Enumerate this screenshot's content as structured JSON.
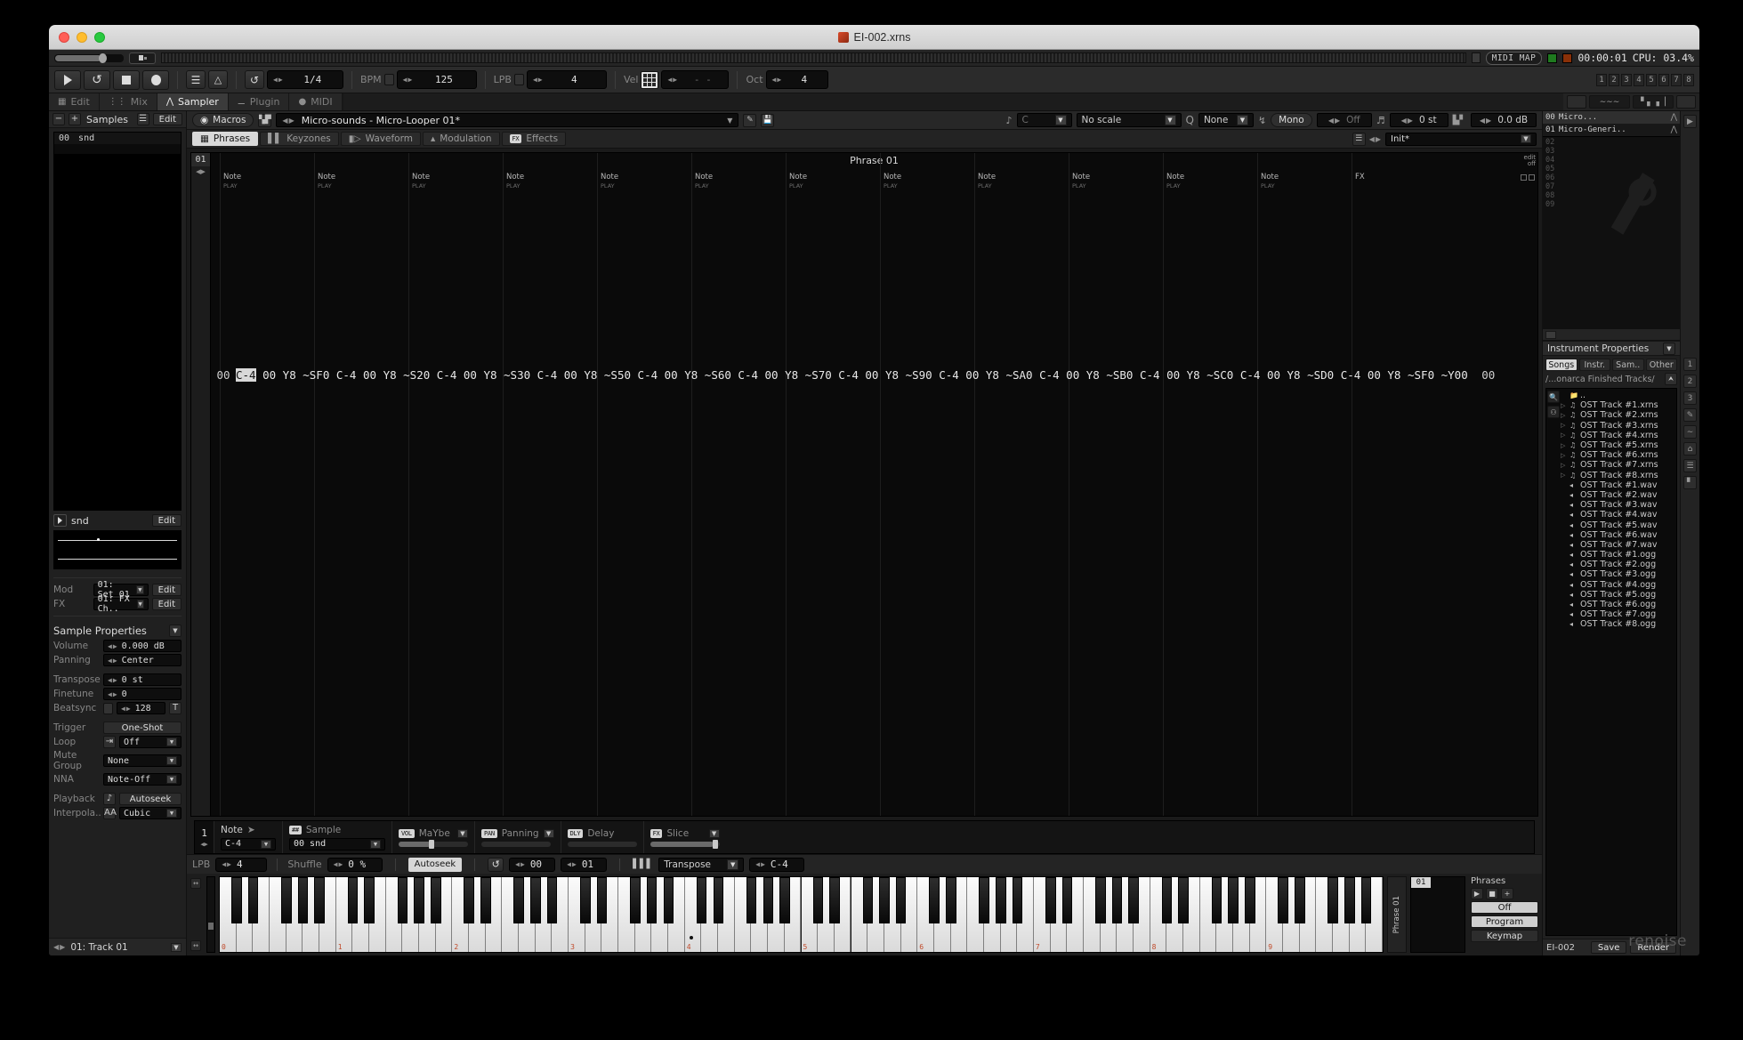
{
  "window": {
    "title": "EI-002.xrns",
    "app_icon": "renoise-icon",
    "branding": "renoise"
  },
  "master_strip": {
    "midi_map_label": "MIDI MAP",
    "time": "00:00:01",
    "cpu": "CPU: 03.4%"
  },
  "transport": {
    "play": "play-button",
    "loop": "loop-button",
    "stop": "stop-button",
    "record": "record-button",
    "metronome_icon": "metronome-icon",
    "pattern_follow_icon": "follow-icon",
    "edit_step_loop_icon": "loop-icon",
    "edit_step": "1/4",
    "bpm_label": "BPM",
    "bpm": "125",
    "lpb_label": "LPB",
    "lpb": "4",
    "vel_label": "Vel",
    "vel": "- -",
    "oct_label": "Oct",
    "oct": "4",
    "seq_numbers": [
      "1",
      "2",
      "3",
      "4",
      "5",
      "6",
      "7",
      "8"
    ]
  },
  "top_tabs": [
    {
      "label": "Edit",
      "icon": "grid-icon",
      "active": false
    },
    {
      "label": "Mix",
      "icon": "faders-icon",
      "active": false
    },
    {
      "label": "Sampler",
      "icon": "waveform-icon",
      "active": true
    },
    {
      "label": "Plugin",
      "icon": "plug-icon",
      "active": false
    },
    {
      "label": "MIDI",
      "icon": "midi-icon",
      "active": false
    }
  ],
  "left_panel": {
    "header": {
      "minus": "−",
      "plus": "+",
      "title": "Samples",
      "list_icon": "list-icon",
      "edit": "Edit"
    },
    "sample_rows": [
      {
        "index": "00",
        "name": "snd"
      }
    ],
    "sample_name": "snd",
    "sample_edit": "Edit",
    "mod_label": "Mod",
    "mod_value": "01: Set 01",
    "mod_edit": "Edit",
    "fx_label": "FX",
    "fx_value": "01: FX Ch..",
    "fx_edit": "Edit",
    "properties_title": "Sample Properties",
    "properties": [
      {
        "label": "Volume",
        "value": "0.000 dB",
        "kind": "spin"
      },
      {
        "label": "Panning",
        "value": "Center",
        "kind": "spin"
      },
      {
        "label": "Transpose",
        "value": "0 st",
        "kind": "spin"
      },
      {
        "label": "Finetune",
        "value": "0",
        "kind": "spin"
      },
      {
        "label": "Beatsync",
        "value": "128",
        "kind": "spin-check",
        "suffix": "T"
      },
      {
        "label": "Trigger",
        "value": "One-Shot",
        "kind": "button"
      },
      {
        "label": "Loop",
        "value": "Off",
        "kind": "dropdown",
        "icon": "loop-range-icon"
      },
      {
        "label": "Mute Group",
        "value": "None",
        "kind": "dropdown"
      },
      {
        "label": "NNA",
        "value": "Note-Off",
        "kind": "dropdown"
      },
      {
        "label": "Playback",
        "value": "Autoseek",
        "kind": "button",
        "icon": "speaker-icon"
      },
      {
        "label": "Interpola..",
        "value": "Cubic",
        "kind": "dropdown",
        "icon": "AA"
      }
    ],
    "track_selector": "01: Track 01"
  },
  "instrument_bar": {
    "macros_label": "Macros",
    "instrument_name": "Micro-sounds - Micro-Looper 01*",
    "key_value": "C",
    "scale_value": "No scale",
    "quantize_label": "Q",
    "quantize_value": "None",
    "mono_label": "Mono",
    "glide_value": "Off",
    "transpose_value": "0 st",
    "volume_value": "0.0 dB"
  },
  "instrument_tabs": [
    {
      "label": "Phrases",
      "icon": "grid-icon",
      "active": true
    },
    {
      "label": "Keyzones",
      "icon": "keyzone-icon",
      "active": false
    },
    {
      "label": "Waveform",
      "icon": "waveform-icon",
      "active": false
    },
    {
      "label": "Modulation",
      "icon": "envelope-icon",
      "active": false
    },
    {
      "label": "Effects",
      "icon": "fx-icon",
      "active": false
    }
  ],
  "preset": {
    "value": "Init*"
  },
  "phrase_editor": {
    "row_index": "01",
    "title": "Phrase 01",
    "edit_mode_label": "edit\noff",
    "column_header_label": "Note",
    "column_header_sub": "PLAY",
    "fx_header": "FX",
    "column_count": 12,
    "row_label_left": "00",
    "row_label_right": "00",
    "pattern_cells": [
      {
        "note": "C-4",
        "vol": "00",
        "pan": "Y8",
        "fx": "~SF0",
        "selected": true
      },
      {
        "note": "C-4",
        "vol": "00",
        "pan": "Y8",
        "fx": "~S20",
        "selected": false
      },
      {
        "note": "C-4",
        "vol": "00",
        "pan": "Y8",
        "fx": "~S30",
        "selected": false
      },
      {
        "note": "C-4",
        "vol": "00",
        "pan": "Y8",
        "fx": "~S50",
        "selected": false
      },
      {
        "note": "C-4",
        "vol": "00",
        "pan": "Y8",
        "fx": "~S60",
        "selected": false
      },
      {
        "note": "C-4",
        "vol": "00",
        "pan": "Y8",
        "fx": "~S70",
        "selected": false
      },
      {
        "note": "C-4",
        "vol": "00",
        "pan": "Y8",
        "fx": "~S90",
        "selected": false
      },
      {
        "note": "C-4",
        "vol": "00",
        "pan": "Y8",
        "fx": "~SA0",
        "selected": false
      },
      {
        "note": "C-4",
        "vol": "00",
        "pan": "Y8",
        "fx": "~SB0",
        "selected": false
      },
      {
        "note": "C-4",
        "vol": "00",
        "pan": "Y8",
        "fx": "~SC0",
        "selected": false
      },
      {
        "note": "C-4",
        "vol": "00",
        "pan": "Y8",
        "fx": "~SD0",
        "selected": false
      },
      {
        "note": "C-4",
        "vol": "00",
        "pan": "Y8",
        "fx": "~SF0",
        "selected": false
      }
    ],
    "trailing_cell": "~Y00"
  },
  "note_controls": {
    "index": "1",
    "note_label": "Note",
    "note_value": "C-4",
    "sample_label": "Sample",
    "sample_tag": "##",
    "sample_value": "00 snd",
    "vol_tag": "VOL",
    "vol_label": "MaYbe",
    "pan_tag": "PAN",
    "pan_label": "Panning",
    "dly_tag": "DLY",
    "dly_label": "Delay",
    "fx_tag": "FX",
    "fx_label": "Slice"
  },
  "lpb_bar": {
    "lpb_label": "LPB",
    "lpb_value": "4",
    "shuffle_label": "Shuffle",
    "shuffle_value": "0 %",
    "autoseek_label": "Autoseek",
    "loop_icon": "loop-icon",
    "loop_start": "00",
    "loop_end": "01",
    "transpose_label": "Transpose",
    "transpose_value": "C-4"
  },
  "keyboard": {
    "octave_labels": [
      "0",
      "1",
      "2",
      "3",
      "4",
      "5",
      "6",
      "7",
      "8",
      "9"
    ],
    "marked_key": "C-4"
  },
  "phrase_panel": {
    "title": "Phrases",
    "column_label": "Phrase 01",
    "grid_index": "01",
    "off_label": "Off",
    "program_label": "Program",
    "keymap_label": "Keymap",
    "play_icon": "play-icon",
    "stop_icon": "stop-icon",
    "plus": "+",
    "minus": "−"
  },
  "right_panel": {
    "instruments": [
      {
        "index": "00",
        "name": "Micro...",
        "selected": true
      },
      {
        "index": "01",
        "name": "Micro-Generi..",
        "selected": false
      }
    ],
    "slot_numbers": [
      "02",
      "03",
      "04",
      "05",
      "06",
      "07",
      "08",
      "09"
    ],
    "properties_title": "Instrument Properties",
    "browser_tabs": [
      {
        "label": "Songs",
        "active": true
      },
      {
        "label": "Instr.",
        "active": false
      },
      {
        "label": "Sam..",
        "active": false
      },
      {
        "label": "Other",
        "active": false
      }
    ],
    "path": "/...onarca Finished Tracks/",
    "up_icon": "arrow-up-icon",
    "search_icon": "search-icon",
    "random_icon": "dice-icon",
    "folder_up": "..",
    "files": [
      {
        "name": "OST Track #1.xrns",
        "kind": "song"
      },
      {
        "name": "OST Track #2.xrns",
        "kind": "song"
      },
      {
        "name": "OST Track #3.xrns",
        "kind": "song"
      },
      {
        "name": "OST Track #4.xrns",
        "kind": "song"
      },
      {
        "name": "OST Track #5.xrns",
        "kind": "song"
      },
      {
        "name": "OST Track #6.xrns",
        "kind": "song"
      },
      {
        "name": "OST Track #7.xrns",
        "kind": "song"
      },
      {
        "name": "OST Track #8.xrns",
        "kind": "song"
      },
      {
        "name": "OST Track #1.wav",
        "kind": "audio"
      },
      {
        "name": "OST Track #2.wav",
        "kind": "audio"
      },
      {
        "name": "OST Track #3.wav",
        "kind": "audio"
      },
      {
        "name": "OST Track #4.wav",
        "kind": "audio"
      },
      {
        "name": "OST Track #5.wav",
        "kind": "audio"
      },
      {
        "name": "OST Track #6.wav",
        "kind": "audio"
      },
      {
        "name": "OST Track #7.wav",
        "kind": "audio"
      },
      {
        "name": "OST Track #1.ogg",
        "kind": "audio"
      },
      {
        "name": "OST Track #2.ogg",
        "kind": "audio"
      },
      {
        "name": "OST Track #3.ogg",
        "kind": "audio"
      },
      {
        "name": "OST Track #4.ogg",
        "kind": "audio"
      },
      {
        "name": "OST Track #5.ogg",
        "kind": "audio"
      },
      {
        "name": "OST Track #6.ogg",
        "kind": "audio"
      },
      {
        "name": "OST Track #7.ogg",
        "kind": "audio"
      },
      {
        "name": "OST Track #8.ogg",
        "kind": "audio"
      }
    ],
    "save_bar": {
      "name": "EI-002",
      "save": "Save",
      "render": "Render"
    }
  },
  "colors": {
    "accent_red": "#c14a2a",
    "selection": "#d8d8d8",
    "panel_bg": "#202020",
    "editor_bg": "#0a0a0a",
    "led_green": "#1f7a1f",
    "led_red": "#8a3008"
  }
}
